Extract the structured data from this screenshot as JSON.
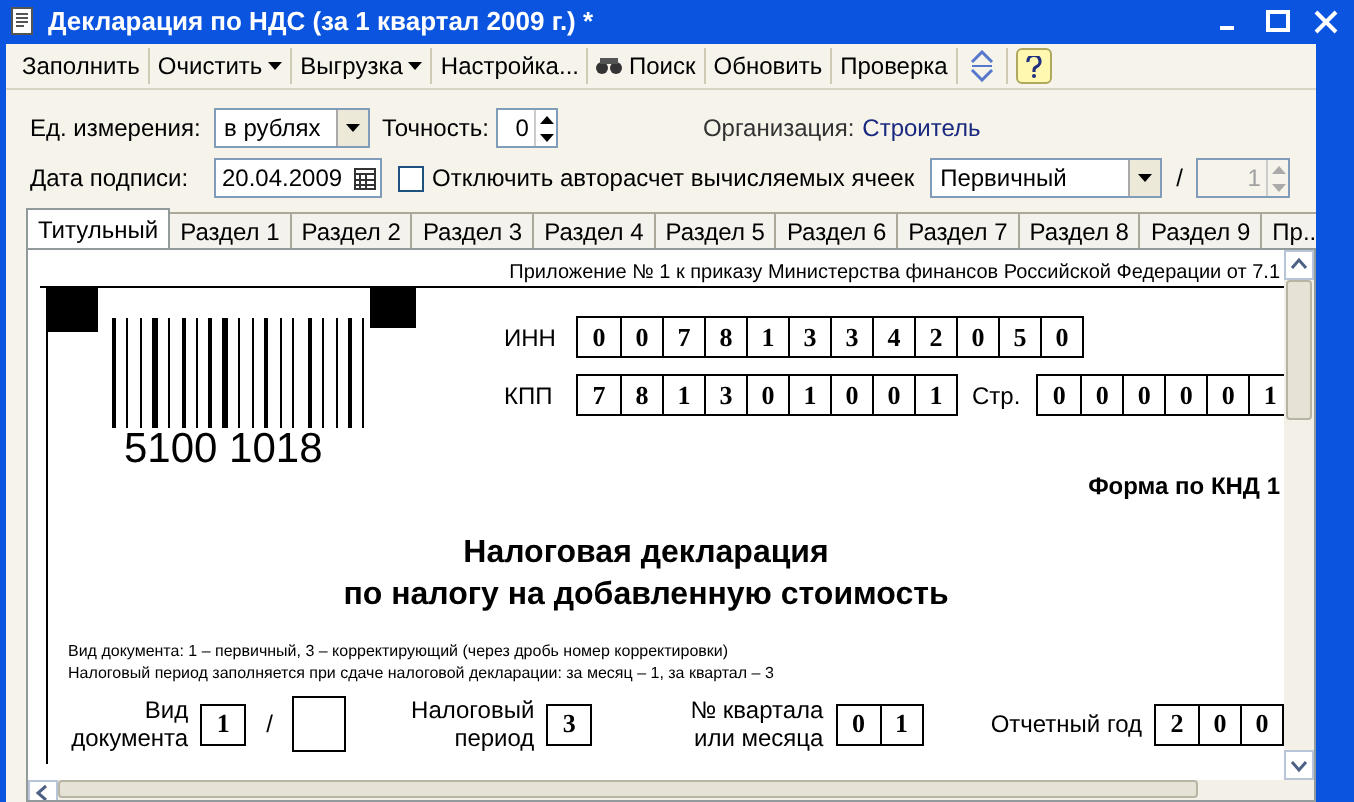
{
  "window": {
    "title": "Декларация по НДС (за 1 квартал 2009 г.) *"
  },
  "toolbar": [
    {
      "label": "Заполнить",
      "kind": "plain"
    },
    {
      "label": "Очистить",
      "kind": "dropdown"
    },
    {
      "label": "Выгрузка",
      "kind": "dropdown"
    },
    {
      "label": "Настройка...",
      "kind": "plain"
    },
    {
      "label": "Поиск",
      "kind": "search"
    },
    {
      "label": "Обновить",
      "kind": "plain"
    },
    {
      "label": "Проверка",
      "kind": "plain"
    },
    {
      "kind": "expand"
    },
    {
      "kind": "help"
    }
  ],
  "form": {
    "unit_label": "Ед. измерения:",
    "unit_value": "в рублях",
    "precision_label": "Точность:",
    "precision_value": "0",
    "organization_label": "Организация:",
    "organization_value": "Строитель",
    "date_label": "Дата подписи:",
    "date_value": "20.04.2009",
    "autocalc_label": "Отключить авторасчет вычисляемых ячеек",
    "autocalc_checked": false,
    "doc_type_value": "Первичный",
    "separator": "/",
    "correction_value": "1",
    "correction_disabled": true
  },
  "tabs": [
    {
      "label": "Титульный",
      "selected": true
    },
    {
      "label": "Раздел 1",
      "selected": false
    },
    {
      "label": "Раздел 2",
      "selected": false
    },
    {
      "label": "Раздел 3",
      "selected": false
    },
    {
      "label": "Раздел 4",
      "selected": false
    },
    {
      "label": "Раздел 5",
      "selected": false
    },
    {
      "label": "Раздел 6",
      "selected": false
    },
    {
      "label": "Раздел 7",
      "selected": false
    },
    {
      "label": "Раздел 8",
      "selected": false
    },
    {
      "label": "Раздел 9",
      "selected": false
    },
    {
      "label": "Пр...",
      "selected": false
    }
  ],
  "document": {
    "header": "Приложение № 1 к приказу Министерства финансов Российской Федерации от 7.1",
    "barcode_number": "5100 1018",
    "inn_label": "ИНН",
    "inn": [
      "0",
      "0",
      "7",
      "8",
      "1",
      "3",
      "3",
      "4",
      "2",
      "0",
      "5",
      "0"
    ],
    "kpp_label": "КПП",
    "kpp": [
      "7",
      "8",
      "1",
      "3",
      "0",
      "1",
      "0",
      "0",
      "1"
    ],
    "page_label": "Стр.",
    "page": [
      "0",
      "0",
      "0",
      "0",
      "0",
      "1"
    ],
    "form_code": "Форма по КНД 1",
    "title_lines": [
      "Налоговая декларация",
      "по налогу на добавленную стоимость"
    ],
    "notes": [
      "Вид документа: 1 – первичный, 3 – корректирующий (через дробь номер корректировки)",
      "Налоговый период заполняется при сдаче налоговой декларации: за месяц – 1, за квартал – 3"
    ],
    "doc_kind_label": "Вид документа",
    "doc_kind": [
      "1"
    ],
    "doc_kind_separator": "/",
    "period_label": "Налоговый период",
    "period": [
      "3"
    ],
    "quarter_label": "№ квартала или месяца",
    "quarter": [
      "0",
      "1"
    ],
    "year_label": "Отчетный год",
    "year": [
      "2",
      "0",
      "0"
    ]
  }
}
